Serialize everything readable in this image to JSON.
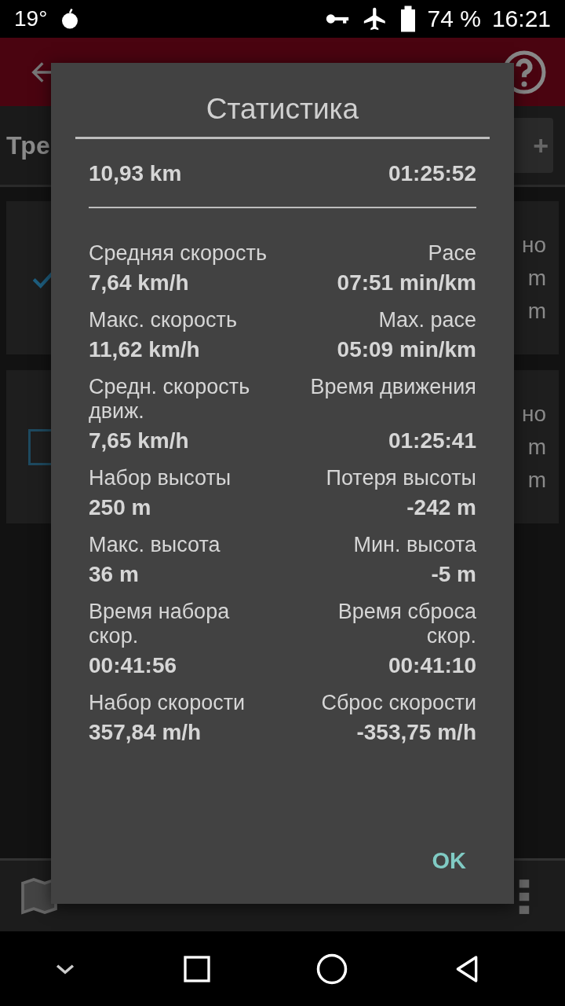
{
  "status_bar": {
    "temperature": "19°",
    "battery": "74 %",
    "time": "16:21"
  },
  "track_list": {
    "title": "Тре",
    "add_button": "+",
    "cards": [
      {
        "checked": true,
        "lines": [
          "но",
          "m",
          "m"
        ]
      },
      {
        "checked": false,
        "lines": [
          "но",
          "m",
          "m"
        ]
      }
    ]
  },
  "dialog": {
    "title": "Статистика",
    "summary": {
      "distance": "10,93 km",
      "duration": "01:25:52"
    },
    "stats": [
      {
        "left_label": "Средняя скорость",
        "left_value": "7,64 km/h",
        "right_label": "Pace",
        "right_value": "07:51 min/km"
      },
      {
        "left_label": "Макс. скорость",
        "left_value": "11,62 km/h",
        "right_label": "Max. pace",
        "right_value": "05:09 min/km"
      },
      {
        "left_label": "Средн. скорость движ.",
        "left_value": "7,65 km/h",
        "right_label": "Время движения",
        "right_value": "01:25:41"
      },
      {
        "left_label": "Набор высоты",
        "left_value": "250 m",
        "right_label": "Потеря высоты",
        "right_value": "-242 m"
      },
      {
        "left_label": "Макс. высота",
        "left_value": "36 m",
        "right_label": "Мин. высота",
        "right_value": "-5 m"
      },
      {
        "left_label": "Время набора скор.",
        "left_value": "00:41:56",
        "right_label": "Время сброса скор.",
        "right_value": "00:41:10"
      },
      {
        "left_label": "Набор скорости",
        "left_value": "357,84 m/h",
        "right_label": "Сброс скорости",
        "right_value": "-353,75 m/h"
      }
    ],
    "button": "OK"
  }
}
